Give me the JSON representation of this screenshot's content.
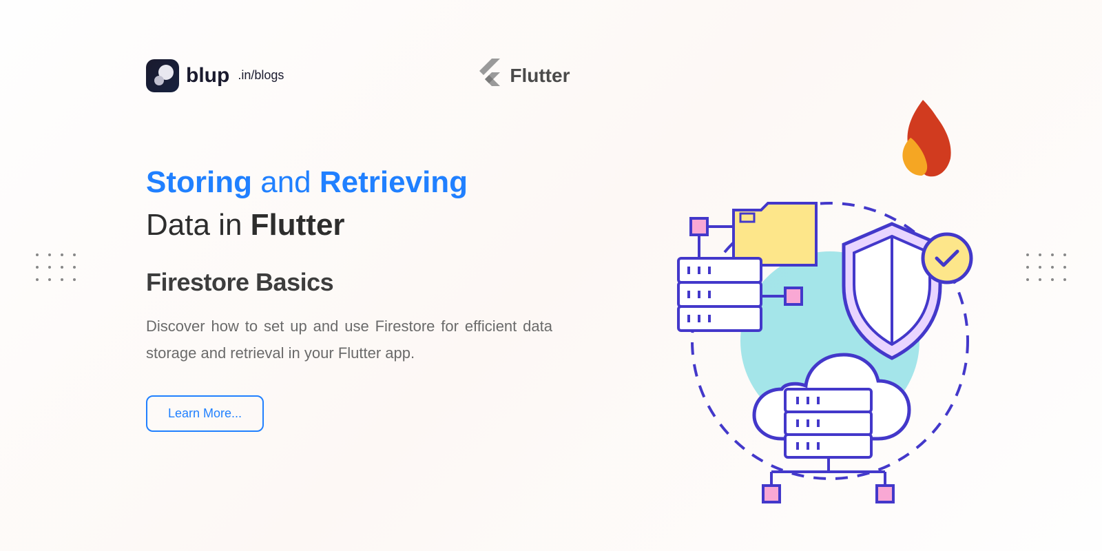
{
  "header": {
    "brand_name": "blup",
    "brand_suffix": ".in/blogs",
    "flutter_label": "Flutter"
  },
  "hero": {
    "title_part1": "Storing",
    "title_part2": "and",
    "title_part3": "Retrieving",
    "title_part4": "Data in",
    "title_part5": "Flutter",
    "subtitle": "Firestore Basics",
    "description": "Discover how to set up and use Firestore for efficient data storage and retrieval in your Flutter app.",
    "cta_label": "Learn More..."
  }
}
